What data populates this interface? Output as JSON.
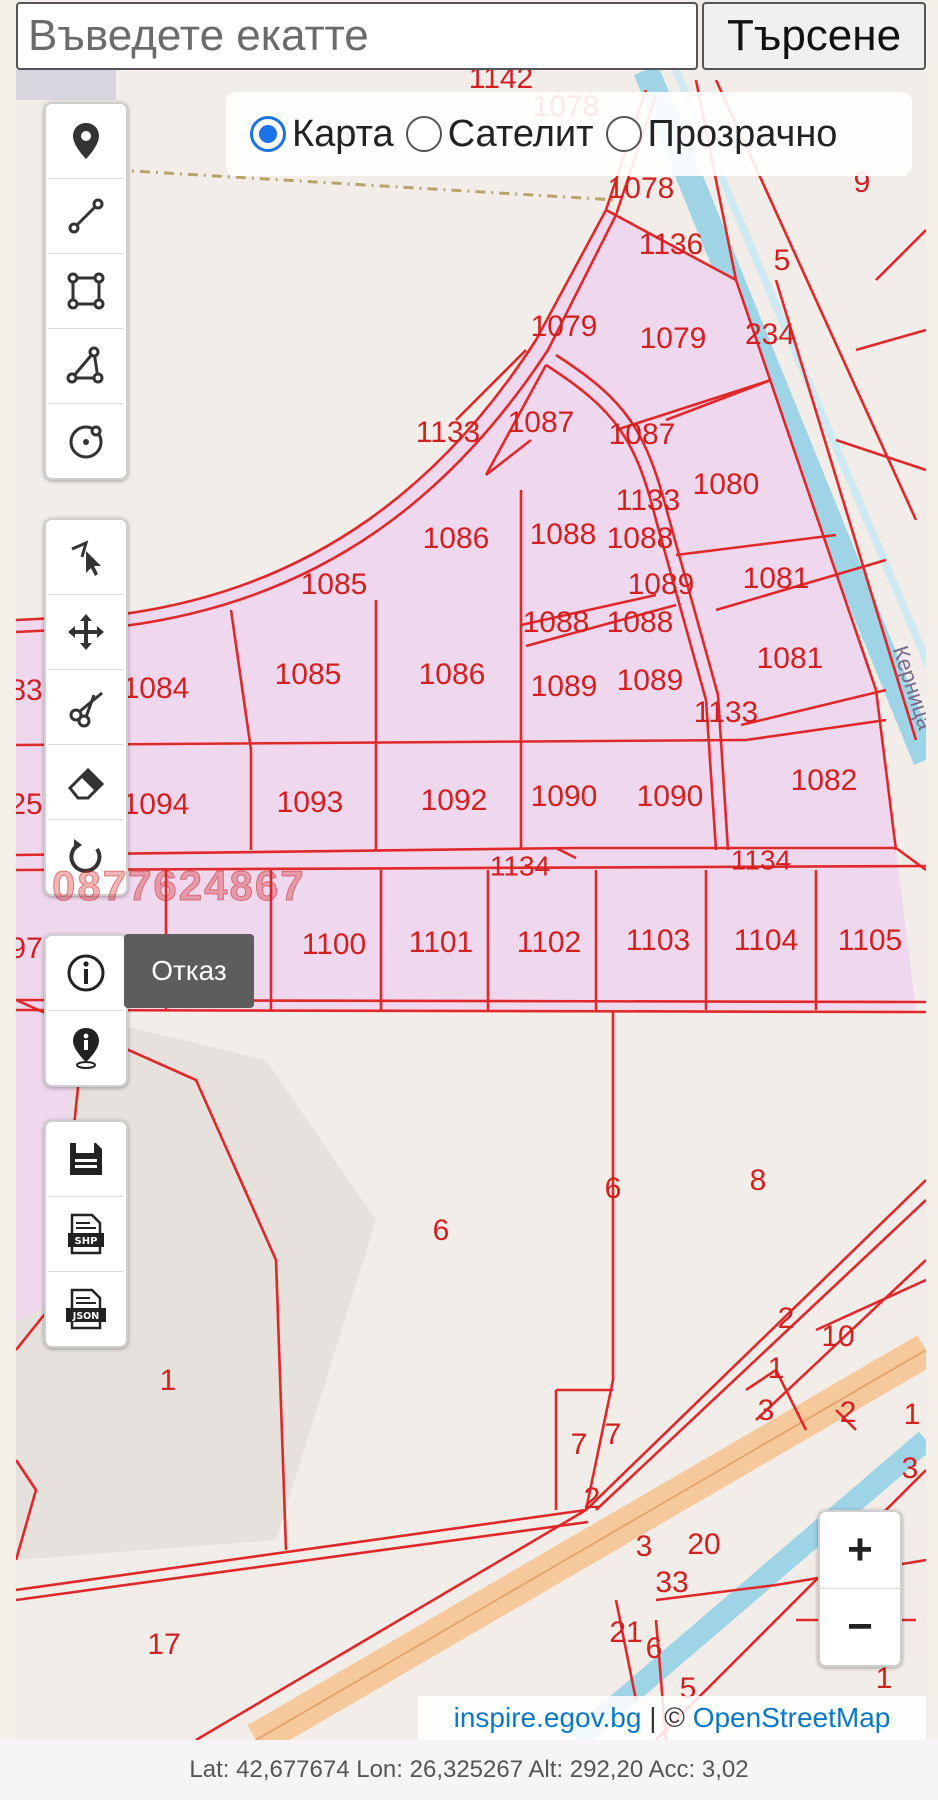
{
  "search": {
    "placeholder": "Въведете екатте",
    "button_label": "Търсене"
  },
  "layers": {
    "selected": "Карта",
    "options": [
      {
        "label": "Карта",
        "selected": true
      },
      {
        "label": "Сателит",
        "selected": false
      },
      {
        "label": "Прозрачно",
        "selected": false
      }
    ]
  },
  "toolbar": {
    "group1": [
      "marker-icon",
      "line-icon",
      "rectangle-icon",
      "polygon-icon",
      "circle-icon"
    ],
    "group2": [
      "edit-vertices-icon",
      "move-icon",
      "cut-icon",
      "eraser-icon",
      "rotate-icon"
    ],
    "group3": [
      "info-icon",
      "location-info-icon"
    ],
    "group4": [
      "save-icon",
      "shp-export-icon",
      "json-export-icon"
    ]
  },
  "tooltip": {
    "label": "Отказ"
  },
  "watermark": {
    "phone": "0877624867"
  },
  "map": {
    "parcel_labels": [
      "1142",
      "1078",
      "1078",
      "1136",
      "1079",
      "1079",
      "234",
      "1087",
      "1087",
      "1133",
      "1080",
      "1133",
      "1088",
      "1088",
      "1086",
      "1085",
      "1089",
      "1081",
      "1088",
      "1088",
      "1084",
      "1085",
      "1086",
      "1089",
      "1089",
      "1081",
      "1133",
      "1094",
      "1093",
      "1092",
      "1090",
      "1090",
      "1082",
      "1134",
      "1134",
      "1100",
      "1101",
      "1102",
      "1103",
      "1104",
      "1105",
      "9",
      "5",
      "6",
      "8",
      "6",
      "2",
      "10",
      "1",
      "1",
      "7",
      "7",
      "2",
      "3",
      "2",
      "1",
      "3",
      "3",
      "20",
      "33",
      "21",
      "6",
      "5",
      "1",
      "17",
      "83",
      "25",
      "97"
    ],
    "street_label": "Керница",
    "fill_color": "#efd8ee",
    "line_color": "#e0282a"
  },
  "zoom": {
    "in": "+",
    "out": "−"
  },
  "attribution": {
    "source": "inspire.egov.bg",
    "separator": " | © ",
    "osm": "OpenStreetMap"
  },
  "status": {
    "text": "Lat: 42,677674 Lon: 26,325267 Alt: 292,20 Acc: 3,02"
  }
}
